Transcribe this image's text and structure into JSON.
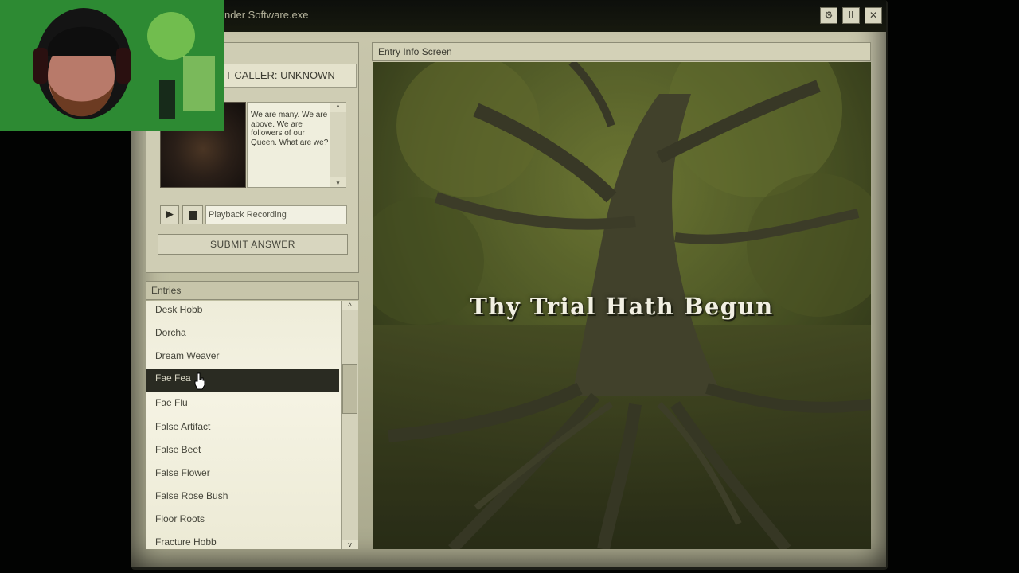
{
  "window": {
    "title": "nder Software.exe",
    "buttons": {
      "settings_icon": "gear-icon",
      "pause_label": "II",
      "close_label": "✕"
    }
  },
  "call": {
    "caller_label": "T CALLER: UNKNOWN",
    "riddle": "We are many. We are above. We are followers of our Queen. What are we?",
    "scroll_up": "^",
    "scroll_down": "v",
    "playback_placeholder": "Playback Recording",
    "submit_label": "SUBMIT ANSWER"
  },
  "entries": {
    "header": "Entries",
    "items": [
      "Desk Hobb",
      "Dorcha",
      "Dream Weaver",
      "Fae Fea",
      "Fae Flu",
      "False Artifact",
      "False Beet",
      "False Flower",
      "False Rose Bush",
      "Floor Roots",
      "Fracture Hobb"
    ],
    "selected_index": 3,
    "scroll_up": "^",
    "scroll_down": "v"
  },
  "info": {
    "header": "Entry Info Screen",
    "headline": "Thy Trial Hath Begun"
  },
  "colors": {
    "panel": "#cfcdb4",
    "selected_row": "#2a2b22",
    "image_tint": "#3b4224"
  }
}
